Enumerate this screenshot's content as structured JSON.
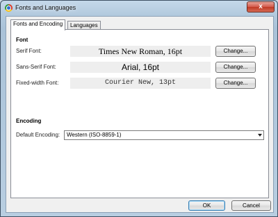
{
  "window": {
    "title": "Fonts and Languages",
    "close_symbol": "x",
    "icon": "chrome-logo-icon"
  },
  "tabs": [
    {
      "label": "Fonts and Encoding",
      "active": true
    },
    {
      "label": "Languages",
      "active": false
    }
  ],
  "font_section": {
    "heading": "Font",
    "rows": [
      {
        "label": "Serif Font:",
        "preview": "Times New Roman, 16pt",
        "button": "Change..."
      },
      {
        "label": "Sans-Serif Font:",
        "preview": "Arial, 16pt",
        "button": "Change..."
      },
      {
        "label": "Fixed-width Font:",
        "preview": "Courier New, 13pt",
        "button": "Change..."
      }
    ]
  },
  "encoding_section": {
    "heading": "Encoding",
    "label": "Default Encoding:",
    "selected": "Western (ISO-8859-1)"
  },
  "footer": {
    "ok_label": "OK",
    "cancel_label": "Cancel"
  },
  "colors": {
    "window_frame": "#b3cade",
    "panel_bg": "#ffffff",
    "preview_bg": "#eeeeee",
    "close_button": "#c03a24"
  }
}
